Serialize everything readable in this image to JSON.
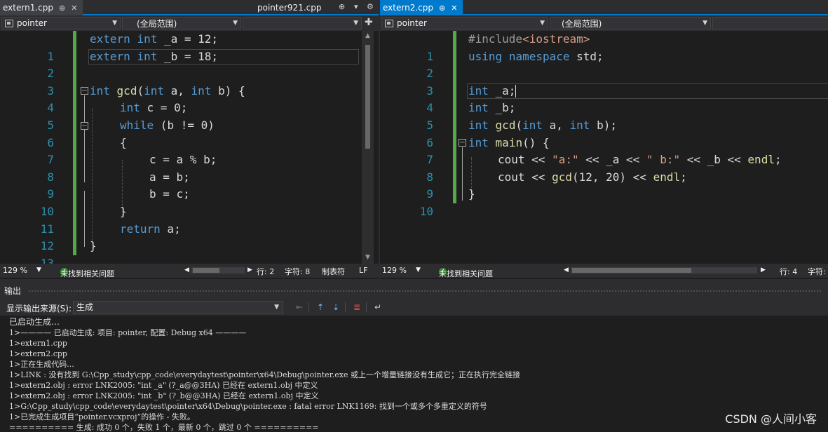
{
  "left_pane": {
    "tabs": [
      {
        "label": "extern1.cpp",
        "pin": "⊕",
        "close": "✕"
      },
      {
        "label": "pointer921.cpp"
      }
    ],
    "tab_dropdown": "▾",
    "tab_gear": "⚙",
    "split_icon": "✚",
    "nav_project": "pointer",
    "nav_scope": "(全局范围)",
    "nav_member": "",
    "lines": [
      {
        "n": "1"
      },
      {
        "n": "2"
      },
      {
        "n": "3"
      },
      {
        "n": "4"
      },
      {
        "n": "5"
      },
      {
        "n": "6"
      },
      {
        "n": "7"
      },
      {
        "n": "8"
      },
      {
        "n": "9"
      },
      {
        "n": "10"
      },
      {
        "n": "11"
      },
      {
        "n": "12"
      },
      {
        "n": "13"
      }
    ],
    "status": {
      "zoom": "129 %",
      "issues": "未找到相关问题",
      "line": "行: 2",
      "char": "字符: 8",
      "tab_mode": "制表符",
      "eol": "LF"
    }
  },
  "right_pane": {
    "tab": {
      "label": "extern2.cpp",
      "pin": "⊕",
      "close": "✕"
    },
    "nav_project": "pointer",
    "nav_scope": "(全局范围)",
    "lines": [
      {
        "n": "1"
      },
      {
        "n": "2"
      },
      {
        "n": "3"
      },
      {
        "n": "4"
      },
      {
        "n": "5"
      },
      {
        "n": "6"
      },
      {
        "n": "7"
      },
      {
        "n": "8"
      },
      {
        "n": "9"
      },
      {
        "n": "10"
      }
    ],
    "status": {
      "zoom": "129 %",
      "issues": "未找到相关问题",
      "line": "行: 4",
      "char": "字符:"
    }
  },
  "code": {
    "extern": "extern",
    "int": "int",
    "while": "while",
    "return": "return",
    "using": "using",
    "namespace": "namespace",
    "include": "#include",
    "iostream": "<iostream>",
    "gcd": "gcd",
    "main": "main",
    "cout": "cout",
    "endl": "endl",
    "l_extern_a_rest": " _a = 12;",
    "l_extern_b_rest": " _b = 18;",
    "l_gcd_open": "(",
    "l_int_a": " a, ",
    "l_int_b_brace": " b) {",
    "l_c_rest": " c = 0;",
    "l_while_rest": " (b != 0)",
    "l_open_brace": "{",
    "l_c_assign": "c = a % b;",
    "l_a_assign": "a = b;",
    "l_b_assign": "b = c;",
    "l_close_brace": "}",
    "l_return_rest": " a;",
    "l_std": " std;",
    "l_int_a_decl": " _a;",
    "l_int_b_decl": " _b;",
    "l_int_b_proto": " b);",
    "l_main_rest": "() {",
    "l_cout1_a": " << ",
    "str_a": "\"a:\"",
    "l_cout1_b": " << _a << ",
    "str_b": "\" b:\"",
    "l_cout1_c": " << _b << ",
    "l_cout1_end": ";",
    "l_cout2_a": " << ",
    "l_cout2_args": "(12, 20) << ",
    "l_cout2_end": ";"
  },
  "output": {
    "title": "输出",
    "source_label": "显示输出来源(S):",
    "source_value": "生成",
    "lines": [
      "已启动生成…",
      "1>———— 已启动生成: 项目: pointer, 配置: Debug x64 ————",
      "1>extern1.cpp",
      "1>extern2.cpp",
      "1>正在生成代码...",
      "1>LINK : 没有找到 G:\\Cpp_study\\cpp_code\\everydaytest\\pointer\\x64\\Debug\\pointer.exe 或上一个增量链接没有生成它；正在执行完全链接",
      "1>extern2.obj : error LNK2005: \"int _a\" (?_a@@3HA) 已经在 extern1.obj 中定义",
      "1>extern2.obj : error LNK2005: \"int _b\" (?_b@@3HA) 已经在 extern1.obj 中定义",
      "1>G:\\Cpp_study\\cpp_code\\everydaytest\\pointer\\x64\\Debug\\pointer.exe : fatal error LNK1169: 找到一个或多个多重定义的符号",
      "1>已完成生成项目“pointer.vcxproj”的操作 - 失败。",
      "========== 生成: 成功 0 个，失败 1 个，最新 0 个，跳过 0 个 =========="
    ]
  },
  "watermark": "CSDN @人间小客",
  "colors": {
    "keyword": "#569cd6",
    "function": "#dcdcaa",
    "string": "#d69d85",
    "line_number": "#2b91af",
    "change_bar": "#57a64a",
    "tab_active": "#007acc"
  }
}
